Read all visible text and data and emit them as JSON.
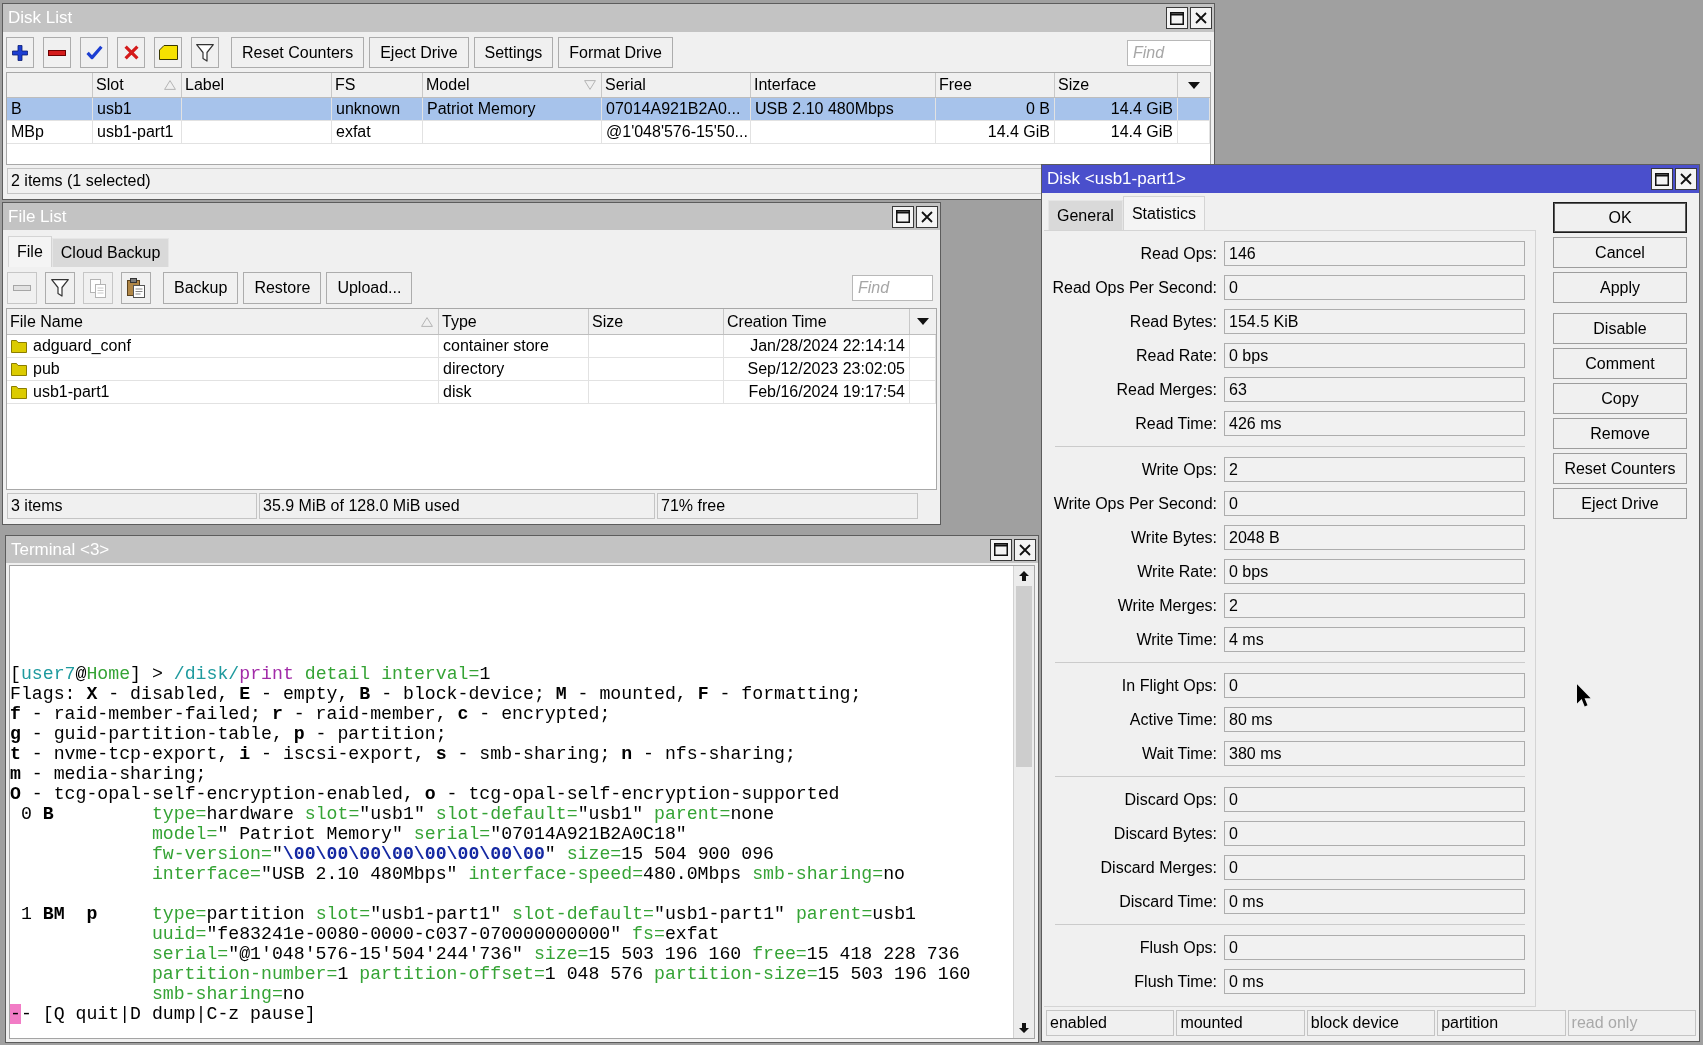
{
  "disk_list": {
    "window": {
      "title": "Disk List",
      "active": false
    },
    "toolbar": {
      "icon_buttons": [
        {
          "kind": "add",
          "disabled": false
        },
        {
          "kind": "remove",
          "disabled": false
        },
        {
          "kind": "enable",
          "disabled": false
        },
        {
          "kind": "disable",
          "disabled": false
        },
        {
          "kind": "comment",
          "disabled": false
        },
        {
          "kind": "filter",
          "disabled": false
        }
      ],
      "buttons": [
        "Reset Counters",
        "Eject Drive",
        "Settings",
        "Format Drive"
      ],
      "find": {
        "placeholder": "Find"
      }
    },
    "table": {
      "columns": [
        {
          "label": "Slot",
          "sorted": true,
          "ascending": true
        },
        {
          "label": "Label",
          "sorted": false
        },
        {
          "label": "FS",
          "sorted": false
        },
        {
          "label": "Model",
          "sorted": true,
          "ascending": false
        },
        {
          "label": "Serial",
          "sorted": false
        },
        {
          "label": "Interface",
          "sorted": false
        },
        {
          "label": "Free",
          "sorted": false
        },
        {
          "label": "Size",
          "sorted": false
        }
      ],
      "rows": [
        {
          "flags": "B",
          "slot": "usb1",
          "fs": "unknown",
          "model": "Patriot Memory",
          "serial": "07014A921B2A0...",
          "interface": "USB 2.10 480Mbps",
          "free": "0 B",
          "size": "14.4 GiB",
          "selected": true
        },
        {
          "flags": "MBp",
          "slot": "usb1-part1",
          "fs": "exfat",
          "serial": "@1'048'576-15'50...",
          "free": "14.4 GiB",
          "size": "14.4 GiB",
          "selected": false
        }
      ]
    },
    "status_bar": "2 items (1 selected)"
  },
  "file_list": {
    "window": {
      "title": "File List",
      "active": false
    },
    "tabs": [
      {
        "label": "File",
        "selected": true
      },
      {
        "label": "Cloud Backup",
        "selected": false
      }
    ],
    "toolbar": {
      "icon_buttons": [
        {
          "kind": "remove",
          "disabled": true
        },
        {
          "kind": "filter",
          "disabled": false
        },
        {
          "kind": "copy",
          "disabled": true
        },
        {
          "kind": "paste",
          "disabled": false
        }
      ],
      "buttons": [
        "Backup",
        "Restore",
        "Upload..."
      ],
      "find": {
        "placeholder": "Find"
      }
    },
    "table": {
      "columns": [
        {
          "label": "File Name",
          "sorted": true,
          "ascending": true
        },
        {
          "label": "Type",
          "sorted": false
        },
        {
          "label": "Size",
          "sorted": false
        },
        {
          "label": "Creation Time",
          "sorted": false
        }
      ],
      "rows": [
        {
          "name": "adguard_conf",
          "type": "container store",
          "time": "Jan/28/2024 22:14:14",
          "selected": false
        },
        {
          "name": "pub",
          "type": "directory",
          "time": "Sep/12/2023 23:02:05",
          "selected": false
        },
        {
          "name": "usb1-part1",
          "type": "disk",
          "time": "Feb/16/2024 19:17:54",
          "selected": false
        }
      ]
    },
    "status_bar": [
      "3 items",
      "35.9 MiB of 128.0 MiB used",
      "71% free"
    ]
  },
  "terminal": {
    "window": {
      "title": "Terminal <3>",
      "active": false
    },
    "lines": [
      {
        "kind": "text",
        "segments": [
          {
            "text": "[",
            "kind": "plain"
          },
          {
            "text": "user7",
            "kind": "user"
          },
          {
            "text": "@",
            "kind": "plain"
          },
          {
            "text": "Home",
            "kind": "host"
          },
          {
            "text": "] > ",
            "kind": "plain"
          },
          {
            "text": "/disk/",
            "kind": "path"
          },
          {
            "text": "print",
            "kind": "command"
          },
          {
            "text": " detail interval=",
            "kind": "param"
          },
          {
            "text": "1",
            "kind": "plain"
          }
        ]
      },
      {
        "kind": "text",
        "segments": [
          {
            "text": "Flags: ",
            "kind": "plain"
          },
          {
            "text": "X",
            "kind": "flag"
          },
          {
            "text": " - disabled, ",
            "kind": "plain"
          },
          {
            "text": "E",
            "kind": "flag"
          },
          {
            "text": " - empty, ",
            "kind": "plain"
          },
          {
            "text": "B",
            "kind": "flag"
          },
          {
            "text": " - block-device; ",
            "kind": "plain"
          },
          {
            "text": "M",
            "kind": "flag"
          },
          {
            "text": " - mounted, ",
            "kind": "plain"
          },
          {
            "text": "F",
            "kind": "flag"
          },
          {
            "text": " - formatting;",
            "kind": "plain"
          }
        ]
      },
      {
        "kind": "text",
        "segments": [
          {
            "text": "f",
            "kind": "flag"
          },
          {
            "text": " - raid-member-failed; ",
            "kind": "plain"
          },
          {
            "text": "r",
            "kind": "flag"
          },
          {
            "text": " - raid-member, ",
            "kind": "plain"
          },
          {
            "text": "c",
            "kind": "flag"
          },
          {
            "text": " - encrypted;",
            "kind": "plain"
          }
        ]
      },
      {
        "kind": "text",
        "segments": [
          {
            "text": "g",
            "kind": "flag"
          },
          {
            "text": " - guid-partition-table, ",
            "kind": "plain"
          },
          {
            "text": "p",
            "kind": "flag"
          },
          {
            "text": " - partition;",
            "kind": "plain"
          }
        ]
      },
      {
        "kind": "text",
        "segments": [
          {
            "text": "t",
            "kind": "flag"
          },
          {
            "text": " - nvme-tcp-export, ",
            "kind": "plain"
          },
          {
            "text": "i",
            "kind": "flag"
          },
          {
            "text": " - iscsi-export, ",
            "kind": "plain"
          },
          {
            "text": "s",
            "kind": "flag"
          },
          {
            "text": " - smb-sharing; ",
            "kind": "plain"
          },
          {
            "text": "n",
            "kind": "flag"
          },
          {
            "text": " - nfs-sharing;",
            "kind": "plain"
          }
        ]
      },
      {
        "kind": "text",
        "segments": [
          {
            "text": "m",
            "kind": "flag"
          },
          {
            "text": " - media-sharing;",
            "kind": "plain"
          }
        ]
      },
      {
        "kind": "text",
        "segments": [
          {
            "text": "O",
            "kind": "flag"
          },
          {
            "text": " - tcg-opal-self-encryption-enabled, ",
            "kind": "plain"
          },
          {
            "text": "o",
            "kind": "flag"
          },
          {
            "text": " - tcg-opal-self-encryption-supported",
            "kind": "plain"
          }
        ]
      },
      {
        "kind": "text",
        "segments": [
          {
            "text": " 0 ",
            "kind": "plain"
          },
          {
            "text": "B",
            "kind": "flag"
          },
          {
            "text": "         type=",
            "kind": "key"
          },
          {
            "text": "hardware",
            "kind": "plain"
          },
          {
            "text": " slot=",
            "kind": "key"
          },
          {
            "text": "\"usb1\"",
            "kind": "plain"
          },
          {
            "text": " slot-default=",
            "kind": "key"
          },
          {
            "text": "\"usb1\"",
            "kind": "plain"
          },
          {
            "text": " parent=",
            "kind": "key"
          },
          {
            "text": "none",
            "kind": "plain"
          }
        ]
      },
      {
        "kind": "detail",
        "segments": [
          {
            "text": "model=",
            "kind": "key"
          },
          {
            "text": "\" Patriot Memory\"",
            "kind": "plain"
          },
          {
            "text": " serial=",
            "kind": "key"
          },
          {
            "text": "\"07014A921B2A0C18\"",
            "kind": "plain"
          }
        ]
      },
      {
        "kind": "detail",
        "segments": [
          {
            "text": "fw-version=",
            "kind": "key"
          },
          {
            "text": "\"",
            "kind": "plain"
          },
          {
            "text": "\\00\\00\\00\\00\\00\\00\\00\\00",
            "kind": "escape"
          },
          {
            "text": "\"",
            "kind": "plain"
          },
          {
            "text": " size=",
            "kind": "key"
          },
          {
            "text": "15 504 900 096",
            "kind": "plain"
          }
        ]
      },
      {
        "kind": "detail",
        "segments": [
          {
            "text": "interface=",
            "kind": "key"
          },
          {
            "text": "\"USB 2.10 480Mbps\"",
            "kind": "plain"
          },
          {
            "text": " interface-speed=",
            "kind": "key"
          },
          {
            "text": "480.0Mbps",
            "kind": "plain"
          },
          {
            "text": " smb-sharing=",
            "kind": "key"
          },
          {
            "text": "no",
            "kind": "plain"
          }
        ]
      },
      {
        "kind": "blank"
      },
      {
        "kind": "text",
        "segments": [
          {
            "text": " 1 ",
            "kind": "plain"
          },
          {
            "text": "BM  p",
            "kind": "flag"
          },
          {
            "text": "     type=",
            "kind": "key"
          },
          {
            "text": "partition",
            "kind": "plain"
          },
          {
            "text": " slot=",
            "kind": "key"
          },
          {
            "text": "\"usb1-part1\"",
            "kind": "plain"
          },
          {
            "text": " slot-default=",
            "kind": "key"
          },
          {
            "text": "\"usb1-part1\"",
            "kind": "plain"
          },
          {
            "text": " parent=",
            "kind": "key"
          },
          {
            "text": "usb1",
            "kind": "plain"
          }
        ]
      },
      {
        "kind": "detail",
        "segments": [
          {
            "text": "uuid=",
            "kind": "key"
          },
          {
            "text": "\"fe83241e-0080-0000-c037-070000000000\"",
            "kind": "plain"
          },
          {
            "text": " fs=",
            "kind": "key"
          },
          {
            "text": "exfat",
            "kind": "plain"
          }
        ]
      },
      {
        "kind": "detail",
        "segments": [
          {
            "text": "serial=",
            "kind": "key"
          },
          {
            "text": "\"@1'048'576-15'504'244'736\"",
            "kind": "plain"
          },
          {
            "text": " size=",
            "kind": "key"
          },
          {
            "text": "15 503 196 160",
            "kind": "plain"
          },
          {
            "text": " free=",
            "kind": "key"
          },
          {
            "text": "15 418 228 736",
            "kind": "plain"
          }
        ]
      },
      {
        "kind": "detail",
        "segments": [
          {
            "text": "partition-number=",
            "kind": "key"
          },
          {
            "text": "1",
            "kind": "plain"
          },
          {
            "text": " partition-offset=",
            "kind": "key"
          },
          {
            "text": "1 048 576",
            "kind": "plain"
          },
          {
            "text": " partition-size=",
            "kind": "key"
          },
          {
            "text": "15 503 196 160",
            "kind": "plain"
          }
        ]
      },
      {
        "kind": "detail",
        "segments": [
          {
            "text": "smb-sharing=",
            "kind": "key"
          },
          {
            "text": "no",
            "kind": "plain"
          }
        ]
      },
      {
        "kind": "text",
        "segments": [
          {
            "text": "-",
            "kind": "cursor"
          },
          {
            "text": "- [Q quit|D dump|C-z pause]",
            "kind": "plain"
          }
        ]
      }
    ]
  },
  "disk_dialog": {
    "window": {
      "title": "Disk <usb1-part1>",
      "active": true
    },
    "tabs": [
      {
        "label": "General",
        "selected": false
      },
      {
        "label": "Statistics",
        "selected": true
      }
    ],
    "field_groups": [
      {
        "fields": [
          {
            "label": "Read Ops:",
            "value": "146"
          },
          {
            "label": "Read Ops Per Second:",
            "value": "0"
          },
          {
            "label": "Read Bytes:",
            "value": "154.5 KiB"
          },
          {
            "label": "Read Rate:",
            "value": "0 bps"
          },
          {
            "label": "Read Merges:",
            "value": "63"
          },
          {
            "label": "Read Time:",
            "value": "426 ms"
          }
        ]
      },
      {
        "fields": [
          {
            "label": "Write Ops:",
            "value": "2"
          },
          {
            "label": "Write Ops Per Second:",
            "value": "0"
          },
          {
            "label": "Write Bytes:",
            "value": "2048 B"
          },
          {
            "label": "Write Rate:",
            "value": "0 bps"
          },
          {
            "label": "Write Merges:",
            "value": "2"
          },
          {
            "label": "Write Time:",
            "value": "4 ms"
          }
        ]
      },
      {
        "fields": [
          {
            "label": "In Flight Ops:",
            "value": "0"
          },
          {
            "label": "Active Time:",
            "value": "80 ms"
          },
          {
            "label": "Wait Time:",
            "value": "380 ms"
          }
        ]
      },
      {
        "fields": [
          {
            "label": "Discard Ops:",
            "value": "0"
          },
          {
            "label": "Discard Bytes:",
            "value": "0"
          },
          {
            "label": "Discard Merges:",
            "value": "0"
          },
          {
            "label": "Discard Time:",
            "value": "0 ms"
          }
        ]
      },
      {
        "fields": [
          {
            "label": "Flush Ops:",
            "value": "0"
          },
          {
            "label": "Flush Time:",
            "value": "0 ms"
          }
        ]
      }
    ],
    "button_groups": [
      {
        "buttons": [
          {
            "label": "OK",
            "default": true
          },
          {
            "label": "Cancel",
            "default": false
          },
          {
            "label": "Apply",
            "default": false
          }
        ]
      },
      {
        "buttons": [
          {
            "label": "Disable",
            "default": false
          },
          {
            "label": "Comment",
            "default": false
          },
          {
            "label": "Copy",
            "default": false
          },
          {
            "label": "Remove",
            "default": false
          },
          {
            "label": "Reset Counters",
            "default": false
          },
          {
            "label": "Eject Drive",
            "default": false
          }
        ]
      }
    ],
    "status_bar": [
      {
        "label": "enabled",
        "disabled": false
      },
      {
        "label": "mounted",
        "disabled": false
      },
      {
        "label": "block device",
        "disabled": false
      },
      {
        "label": "partition",
        "disabled": false
      },
      {
        "label": "read only",
        "disabled": true
      }
    ]
  }
}
